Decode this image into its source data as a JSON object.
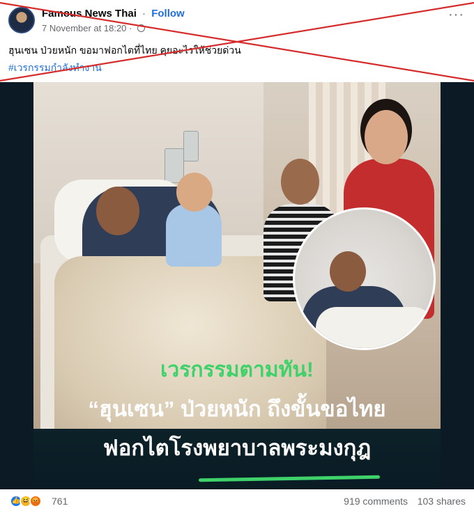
{
  "header": {
    "page_name": "Famous News Thai",
    "separator": "·",
    "follow_label": "Follow",
    "timestamp": "7 November at 18:20 ·",
    "more_label": "···"
  },
  "post": {
    "text": "ฮุนเซน ป่วยหนัก ขอมาฟอกไตที่ไทย คุยอะไรให้ช่วยด่วน",
    "hashtag": "#เวรกรรมกำลังทำงาน"
  },
  "image_caption": {
    "line1": "เวรกรรมตามทัน!",
    "line2": "“ฮุนเซน” ป่วยหนัก ถึงขั้นขอไทย",
    "line3": "ฟอกไตโรงพยาบาลพระมงกุฎ"
  },
  "footer": {
    "reaction_count": "761",
    "comments": "919 comments",
    "shares": "103 shares"
  },
  "icons": {
    "reactions": [
      "like-icon",
      "haha-icon",
      "angry-icon"
    ]
  },
  "colors": {
    "link_blue": "#216fdb",
    "caption_green": "#3fd16a",
    "cross_red": "#d62b2b"
  }
}
